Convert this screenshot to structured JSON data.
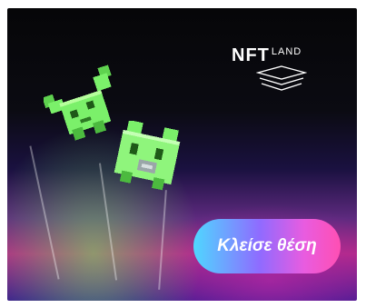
{
  "ad": {
    "logo_main": "NFT",
    "logo_sub": "LAND",
    "cta_label": "Κλείσε θέση"
  },
  "icons": {
    "logo_stack": "stacked-layers-icon",
    "creature_1": "pixel-bat-creature",
    "creature_2": "pixel-frog-creature"
  },
  "colors": {
    "creature_green": "#7bf06a",
    "cta_gradient_start": "#4fd7ff",
    "cta_gradient_end": "#ff4fb3"
  }
}
